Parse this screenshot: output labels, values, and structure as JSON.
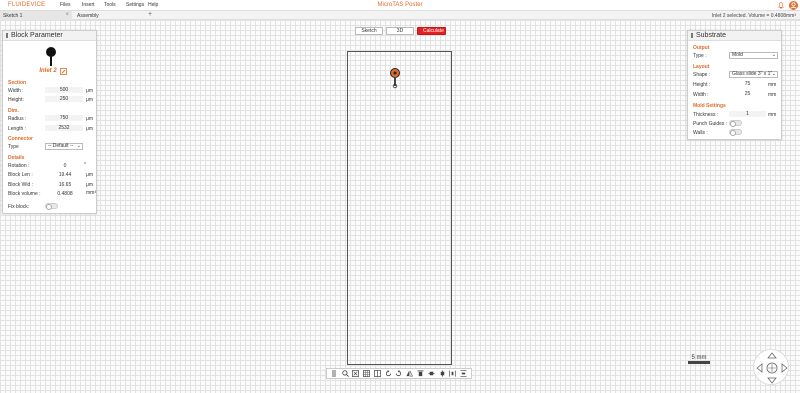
{
  "app": {
    "logo": "FLUIDEVICE",
    "title": "MicroTAS Poster",
    "menu": [
      "Files",
      "Insert",
      "Tools",
      "Settings",
      "Help"
    ],
    "status": "Inlet 2 selected. Volume = 0.4808mm³"
  },
  "tabs": [
    {
      "label": "Sketch 1",
      "active": true
    },
    {
      "label": "Assembly",
      "active": false
    }
  ],
  "view_buttons": {
    "sketch": "Sketch",
    "three_d": "3D",
    "calculate": "Calculate"
  },
  "block_panel": {
    "title": "Block Parameter",
    "block_name": "Inlet 2",
    "section_title": "Section",
    "width_label": "Width :",
    "width_value": "500",
    "width_unit": "μm",
    "height_label": "Height:",
    "height_value": "250",
    "height_unit": "μm",
    "dim_title": "Dim.",
    "radius_label": "Radius :",
    "radius_value": "750",
    "radius_unit": "μm",
    "length_label": "Length :",
    "length_value": "2532",
    "length_unit": "μm",
    "connector_title": "Connector",
    "type_label": "Type",
    "type_value": "-- Default --",
    "details_title": "Details",
    "rotation_label": "Rotation :",
    "rotation_value": "0",
    "rotation_unit": "°",
    "blocklen_label": "Block Len :",
    "blocklen_value": "19.44",
    "blocklen_unit": "μm",
    "blockwid_label": "Block Wid :",
    "blockwid_value": "16.65",
    "blockwid_unit": "μm",
    "blockvol_label": "Block volume :",
    "blockvol_value": "0.4808",
    "blockvol_unit": "mm³",
    "fix_label": "Fix block:"
  },
  "substrate_panel": {
    "title": "Substrate",
    "output_title": "Output",
    "type_label": "Type :",
    "type_value": "Mold",
    "layout_title": "Layout",
    "shape_label": "Shape :",
    "shape_value": "Glass slide 3\" x 1\"",
    "height_label": "Height :",
    "height_value": "75",
    "height_unit": "mm",
    "width_label": "Width :",
    "width_value": "25",
    "width_unit": "mm",
    "mold_title": "Mold Settings",
    "thickness_label": "Thickness :",
    "thickness_value": "1",
    "thickness_unit": "mm",
    "punch_label": "Punch Guides :",
    "walls_label": "Walls :"
  },
  "scale": {
    "label": "5 mm"
  },
  "colors": {
    "accent": "#e06b2a",
    "calculate": "#e42020"
  }
}
